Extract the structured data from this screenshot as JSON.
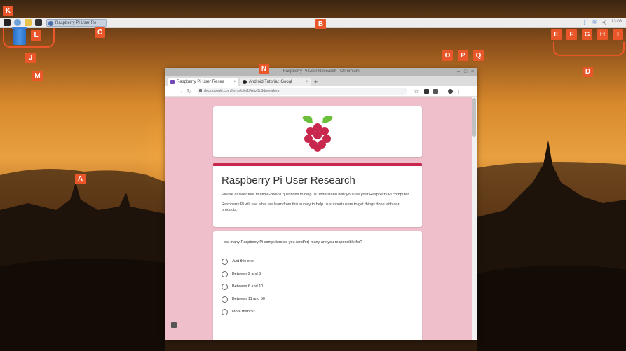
{
  "taskbar": {
    "task_label": "Raspberry Pi User Re",
    "clock": "13:08"
  },
  "browser": {
    "window_title": "Raspberry Pi User Research - Chromium",
    "tabs": [
      {
        "label": "Raspberry Pi User Resea"
      },
      {
        "label": "Android Tutorial: Googl"
      }
    ],
    "url": "docs.google.com/forms/d/e/1FAIpQLSd/viewform"
  },
  "form": {
    "title": "Raspberry Pi User Research",
    "description": [
      "Please answer four multiple-choice questions to help us understand how you use your Raspberry Pi computer.",
      "Raspberry Pi will use what we learn from this survey to help us support users to get things done with our products."
    ],
    "question": "How many Raspberry Pi computers do you (and/or) many are you responsible for?",
    "options": [
      "Just this one",
      "Between 2 and 5",
      "Between 6 and 10",
      "Between 11 and 50",
      "More than 50"
    ]
  },
  "markers": [
    "A",
    "B",
    "C",
    "D",
    "E",
    "F",
    "G",
    "H",
    "I",
    "J",
    "K",
    "L",
    "M",
    "N",
    "O",
    "P",
    "Q"
  ],
  "colors": {
    "marker": "#e8562a",
    "accent": "#c8284d",
    "page_bg": "#efc0cc"
  }
}
